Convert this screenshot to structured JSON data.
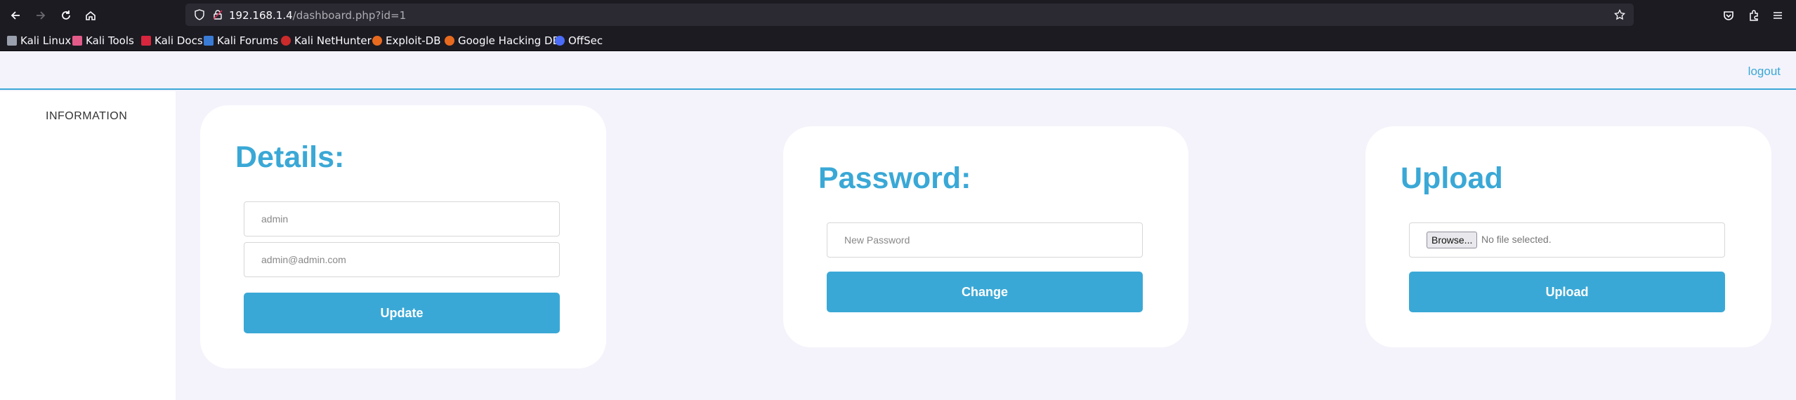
{
  "browser": {
    "url_host": "192.168.1.4",
    "url_path": "/dashboard.php?id=1",
    "bookmarks": [
      "Kali Linux",
      "Kali Tools",
      "Kali Docs",
      "Kali Forums",
      "Kali NetHunter",
      "Exploit-DB",
      "Google Hacking DB",
      "OffSec"
    ]
  },
  "header": {
    "logout_label": "logout"
  },
  "sidebar": {
    "items": [
      {
        "label": "INFORMATION"
      }
    ]
  },
  "details_card": {
    "title": "Details:",
    "username_value": "admin",
    "email_value": "admin@admin.com",
    "button_label": "Update"
  },
  "password_card": {
    "title": "Password:",
    "new_password_placeholder": "New Password",
    "button_label": "Change"
  },
  "upload_card": {
    "title": "Upload",
    "browse_label": "Browse...",
    "file_status": "No file selected.",
    "button_label": "Upload"
  },
  "colors": {
    "accent": "#3aa8d6",
    "page_bg": "#f4f3fb",
    "browser_chrome": "#1c1b22"
  }
}
